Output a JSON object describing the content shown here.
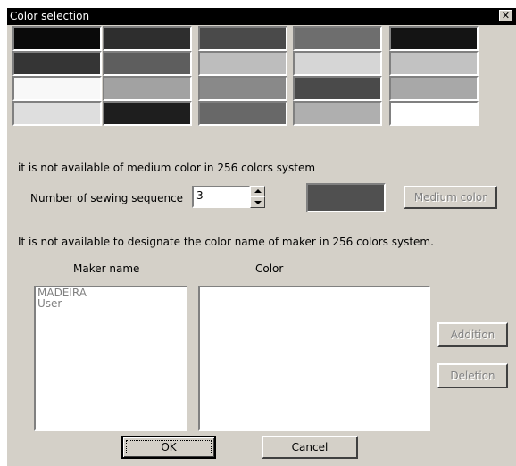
{
  "dialog": {
    "title": "Color selection",
    "close_glyph": "✕"
  },
  "palette": {
    "rows": [
      [
        "#0a0a0a",
        "#2e2e2e",
        "#4a4a4a",
        "#6e6e6e",
        "#141414"
      ],
      [
        "#353535",
        "#5e5e5e",
        "#bdbdbd",
        "#d6d6d6",
        "#c2c2c2"
      ],
      [
        "#f8f8f8",
        "#a2a2a2",
        "#898989",
        "#4a4a4a",
        "#a8a8a8"
      ],
      [
        "#dedede",
        "#1e1e1e",
        "#686868",
        "#afafaf",
        "#ffffff"
      ]
    ]
  },
  "notes": {
    "medium_color": "it is not available of medium color in 256 colors system",
    "maker_name": "It is not available to designate the color name of maker in 256 colors system."
  },
  "sewing": {
    "label": "Number of sewing sequence",
    "value": "3"
  },
  "medium": {
    "color": "#505050",
    "button_label": "Medium color"
  },
  "maker": {
    "header": "Maker name",
    "items": [
      "MADEIRA",
      "User"
    ]
  },
  "color_list": {
    "header": "Color",
    "items": []
  },
  "buttons": {
    "addition": "Addition",
    "deletion": "Deletion",
    "ok": "OK",
    "cancel": "Cancel"
  }
}
